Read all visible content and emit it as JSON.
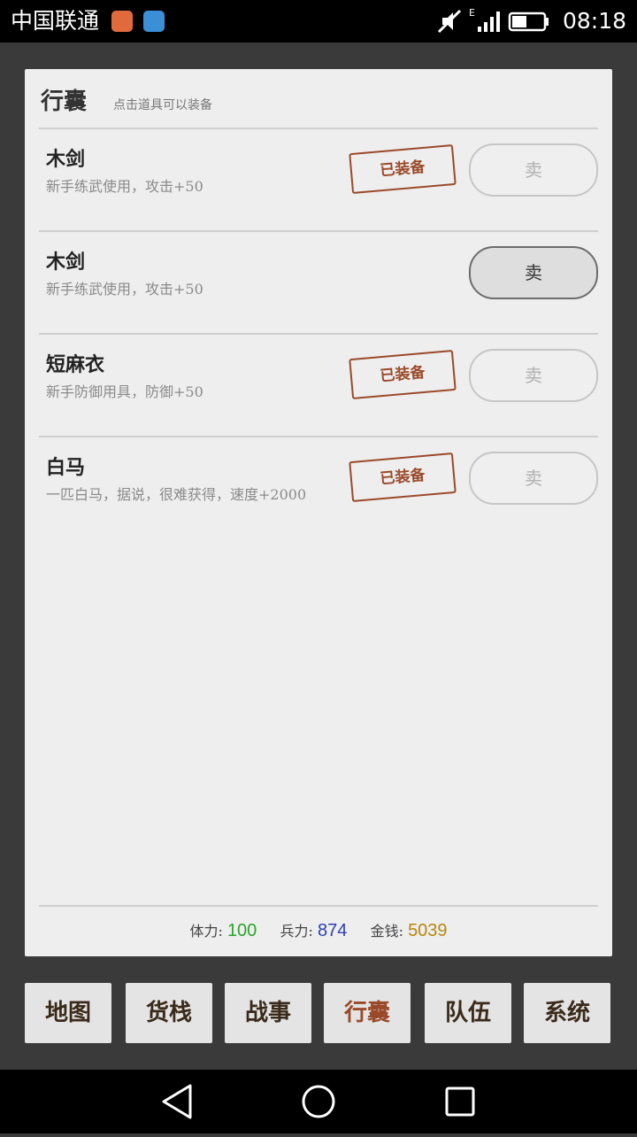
{
  "status_bar": {
    "carrier": "中国联通",
    "time": "08:18",
    "network_type": "E"
  },
  "panel": {
    "title": "行囊",
    "hint": "点击道具可以装备"
  },
  "items": [
    {
      "name": "木剑",
      "description": "新手练武使用，攻击+50",
      "equipped_label": "已装备",
      "equipped": true,
      "sell_label": "卖"
    },
    {
      "name": "木剑",
      "description": "新手练武使用，攻击+50",
      "equipped_label": "",
      "equipped": false,
      "sell_label": "卖"
    },
    {
      "name": "短麻衣",
      "description": "新手防御用具，防御+50",
      "equipped_label": "已装备",
      "equipped": true,
      "sell_label": "卖"
    },
    {
      "name": "白马",
      "description": "一匹白马，据说，很难获得，速度+2000",
      "equipped_label": "已装备",
      "equipped": true,
      "sell_label": "卖"
    }
  ],
  "stats": {
    "stamina_label": "体力:",
    "stamina_value": "100",
    "troops_label": "兵力:",
    "troops_value": "874",
    "money_label": "金钱:",
    "money_value": "5039"
  },
  "tabs": [
    {
      "label": "地图"
    },
    {
      "label": "货栈"
    },
    {
      "label": "战事"
    },
    {
      "label": "行囊"
    },
    {
      "label": "队伍"
    },
    {
      "label": "系统"
    }
  ],
  "colors": {
    "accent": "#9a4a2a",
    "stamina": "#2aa52a",
    "troops": "#2d3fb0",
    "money": "#b8860b"
  }
}
